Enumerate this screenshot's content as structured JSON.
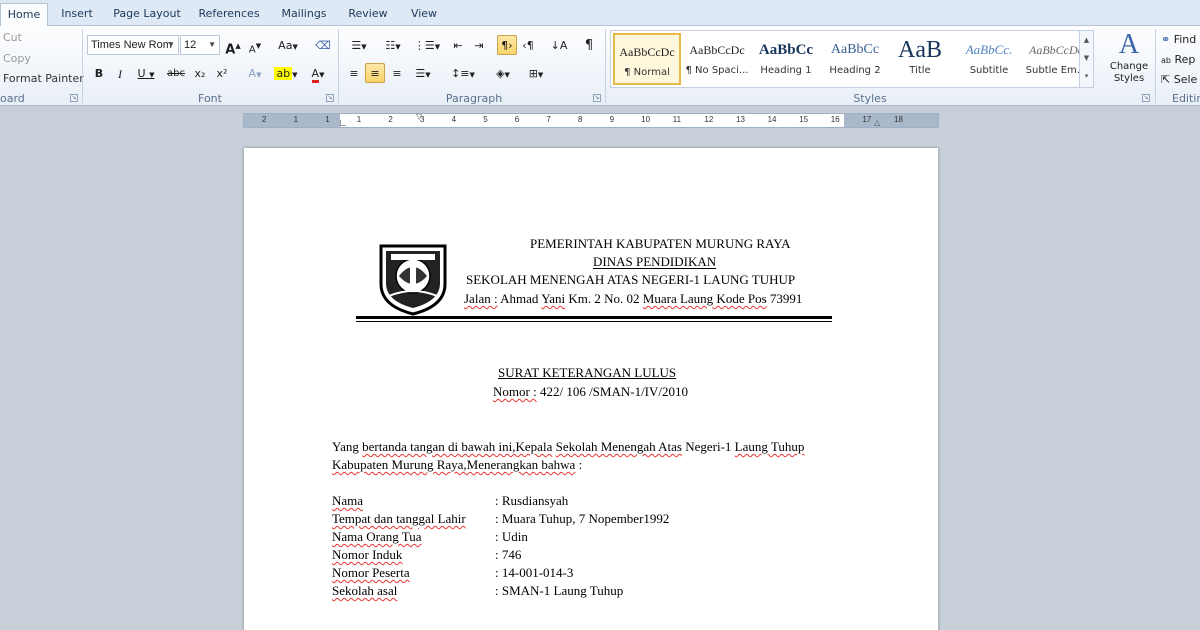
{
  "tabs": [
    {
      "label": "Home",
      "active": true
    },
    {
      "label": "Insert"
    },
    {
      "label": "Page Layout"
    },
    {
      "label": "References"
    },
    {
      "label": "Mailings"
    },
    {
      "label": "Review"
    },
    {
      "label": "View"
    }
  ],
  "clipboard": {
    "cut": "Cut",
    "copy": "Copy",
    "format_painter": "Format Painter",
    "group_label": "oard"
  },
  "font": {
    "family": "Times New Rom",
    "size": "12",
    "grow_label": "A",
    "shrink_label": "A",
    "case_label": "Aa",
    "bold": "B",
    "italic": "I",
    "underline": "U",
    "strike": "abc",
    "subscript": "x₂",
    "superscript": "x²",
    "group_label": "Font"
  },
  "paragraph": {
    "pilcrow": "¶",
    "group_label": "Paragraph"
  },
  "styles": {
    "items": [
      {
        "sample": "AaBbCcDc",
        "name": "¶ Normal",
        "selected": true
      },
      {
        "sample": "AaBbCcDc",
        "name": "¶ No Spaci..."
      },
      {
        "sample": "AaBbCc",
        "name": "Heading 1"
      },
      {
        "sample": "AaBbCc",
        "name": "Heading 2"
      },
      {
        "sample": "AaB",
        "name": "Title"
      },
      {
        "sample": "AaBbCc.",
        "name": "Subtitle"
      },
      {
        "sample": "AaBbCcDc",
        "name": "Subtle Em..."
      }
    ],
    "change_styles": "Change Styles",
    "group_label": "Styles"
  },
  "editing": {
    "find": "Find",
    "replace": "Rep",
    "select": "Sele",
    "group_label": "Editin"
  },
  "ruler": {
    "numbers": [
      "2",
      "1",
      "1",
      "1",
      "2",
      "3",
      "4",
      "5",
      "6",
      "7",
      "8",
      "9",
      "10",
      "11",
      "12",
      "13",
      "14",
      "15",
      "16",
      "17",
      "18"
    ]
  },
  "document": {
    "header": {
      "line1": "PEMERINTAH  KABUPATEN  MURUNG  RAYA",
      "line2": "DINAS  PENDIDIKAN",
      "line3": "SEKOLAH  MENENGAH  ATAS NEGERI-1  LAUNG  TUHUP",
      "address": {
        "jalan": "Jalan :",
        "ahmad": "Ahmad",
        "yani": "Yani",
        "km": "Km.  2  No.  02",
        "muara": "Muara Laung Kode Pos",
        "pos": "73991"
      }
    },
    "title": "SURAT  KETERANGAN  LULUS",
    "nomor_label": "Nomor :",
    "nomor_value": "422/ 106 /SMAN-1/IV/2010",
    "intro_line1": [
      {
        "t": "Yang ",
        "sq": false
      },
      {
        "t": "bertanda tangan di bawah ini,Kepala",
        "sq": true
      },
      {
        "t": "  ",
        "sq": false
      },
      {
        "t": "Sekolah Menengah Atas",
        "sq": true
      },
      {
        "t": " Negeri-1 ",
        "sq": false
      },
      {
        "t": "Laung Tuhup",
        "sq": true
      }
    ],
    "intro_line2": [
      {
        "t": "Kabupaten  Murung Raya,Menerangkan  bahwa",
        "sq": true
      },
      {
        "t": " :",
        "sq": false
      }
    ],
    "fields": [
      {
        "label": "Nama",
        "value": ": Rusdiansyah"
      },
      {
        "label": "Tempat dan tanggal Lahir",
        "value": ": Muara Tuhup, 7 Nopember1992"
      },
      {
        "label": "Nama Orang Tua",
        "value": ": Udin"
      },
      {
        "label": "Nomor Induk",
        "value": ": 746"
      },
      {
        "label": "Nomor Peserta",
        "value": ": 14-001-014-3"
      },
      {
        "label": "Sekolah asal",
        "value": ": SMAN-1 Laung Tuhup"
      }
    ]
  }
}
